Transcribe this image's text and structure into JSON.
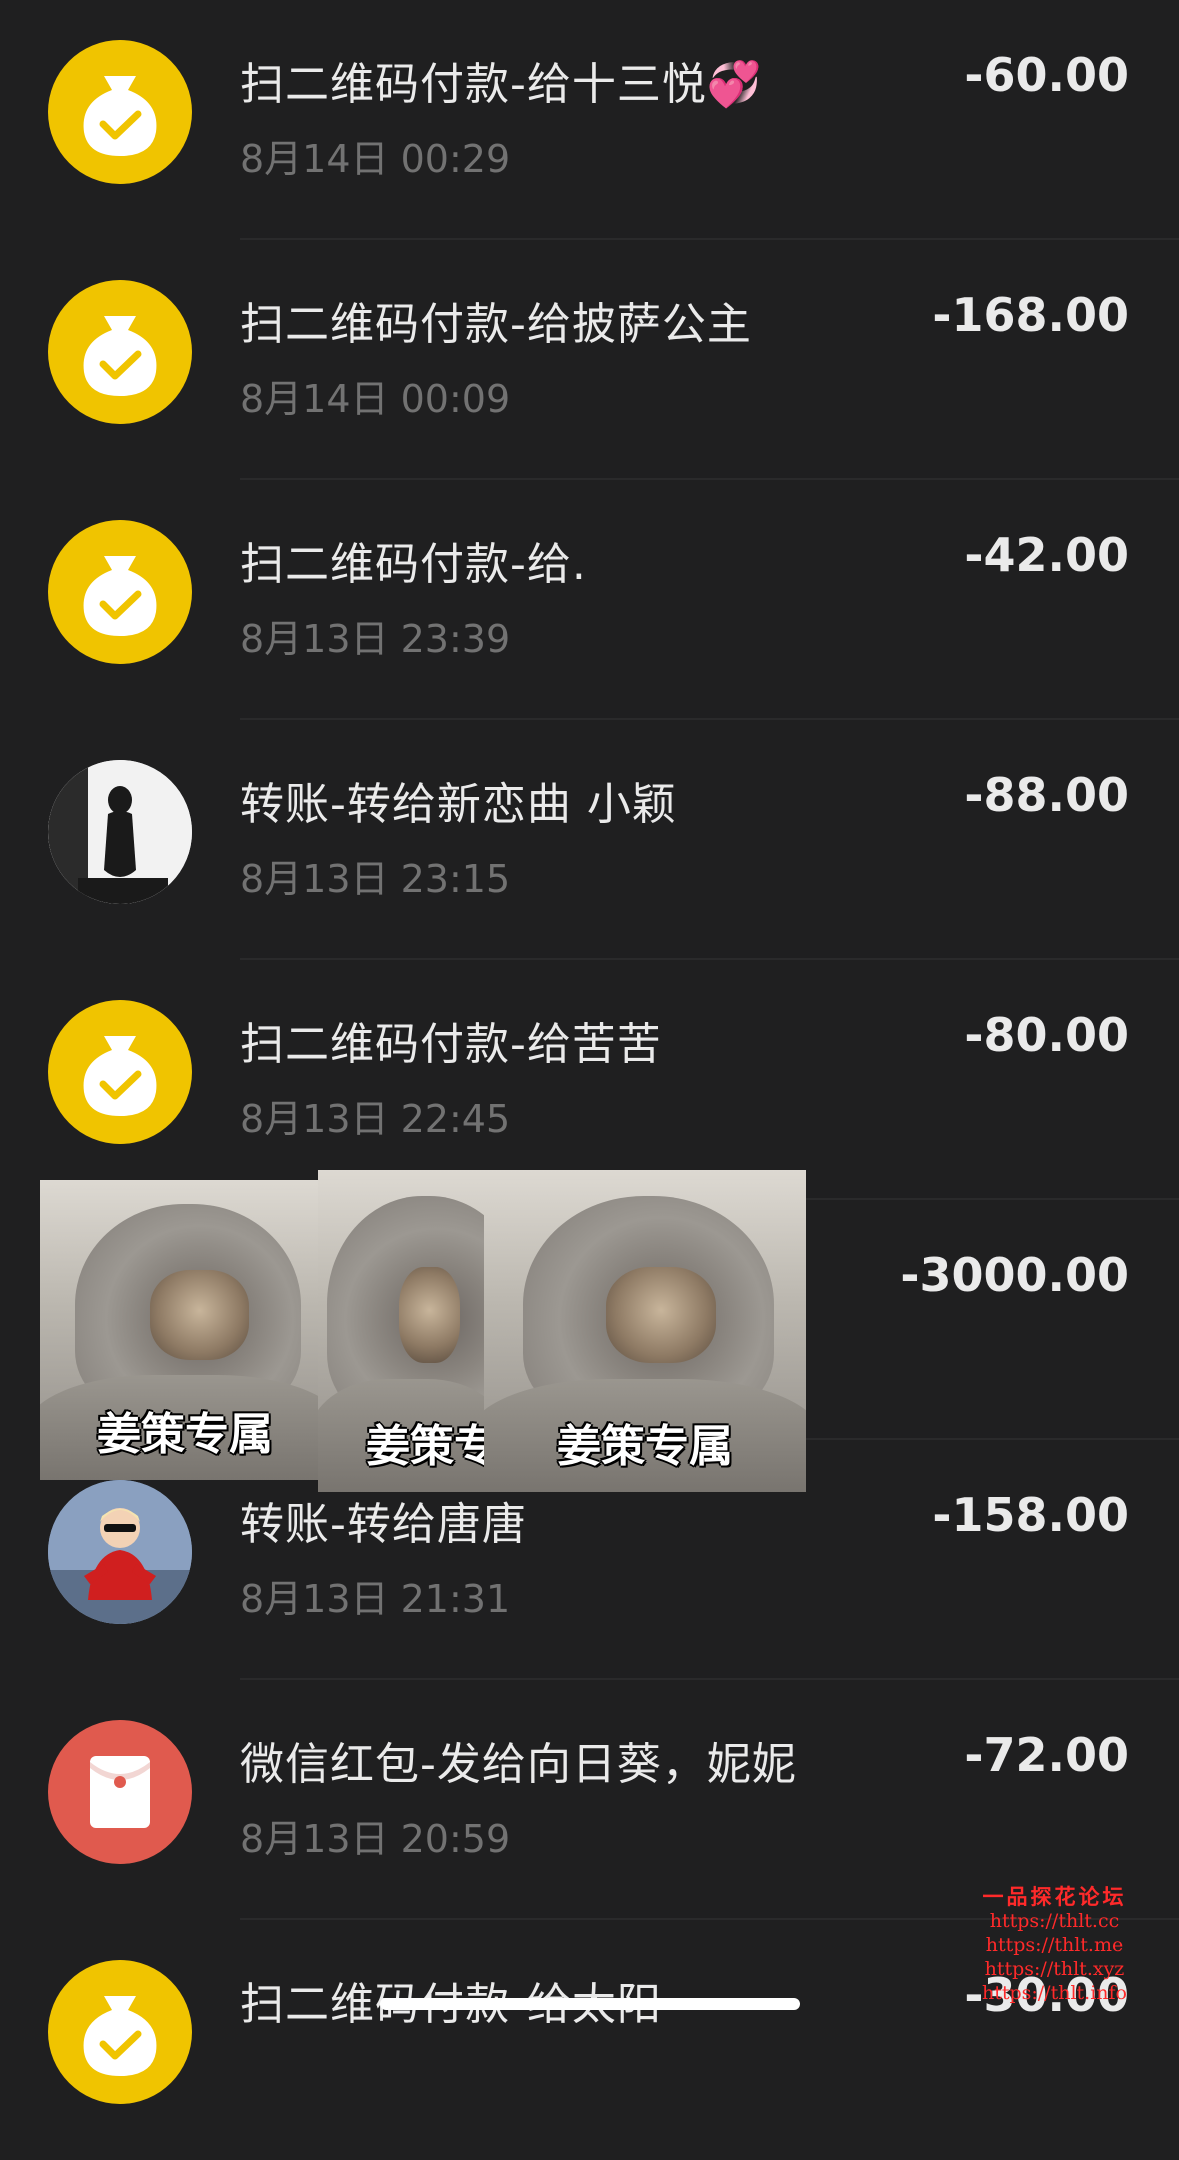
{
  "transactions": [
    {
      "title": "扫二维码付款-给十三悦💞",
      "time": "8月14日 00:29",
      "amount": "-60.00",
      "icon": "money-bag-icon"
    },
    {
      "title": "扫二维码付款-给披萨公主",
      "time": "8月14日 00:09",
      "amount": "-168.00",
      "icon": "money-bag-icon"
    },
    {
      "title": "扫二维码付款-给.",
      "time": "8月13日 23:39",
      "amount": "-42.00",
      "icon": "money-bag-icon"
    },
    {
      "title": "转账-转给新恋曲 小颖",
      "time": "8月13日 23:15",
      "amount": "-88.00",
      "icon": "avatar-photo"
    },
    {
      "title": "扫二维码付款-给苦苦",
      "time": "8月13日 22:45",
      "amount": "-80.00",
      "icon": "money-bag-icon"
    },
    {
      "title": "",
      "time": "",
      "amount": "-3000.00",
      "icon": ""
    },
    {
      "title": "转账-转给唐唐",
      "time": "8月13日 21:31",
      "amount": "-158.00",
      "icon": "avatar-photo"
    },
    {
      "title": "微信红包-发给向日葵，妮妮",
      "time": "8月13日 20:59",
      "amount": "-72.00",
      "icon": "red-packet-icon"
    },
    {
      "title": "扫二维码付款-给太阳",
      "time": "",
      "amount": "-30.00",
      "icon": "money-bag-icon"
    }
  ],
  "stickers": [
    {
      "caption": "姜策专属"
    },
    {
      "caption": "姜策专"
    },
    {
      "caption": "姜策专属"
    }
  ],
  "watermark": {
    "title": "一品探花论坛",
    "lines": [
      "https://thlt.cc",
      "https://thlt.me",
      "https://thlt.xyz",
      "https://thlt.info"
    ]
  },
  "colors": {
    "background": "#1f1f20",
    "pay_icon": "#f0c400",
    "red_packet_icon": "#e05a4e",
    "time_text": "#727272",
    "watermark": "#ff2a2a"
  }
}
